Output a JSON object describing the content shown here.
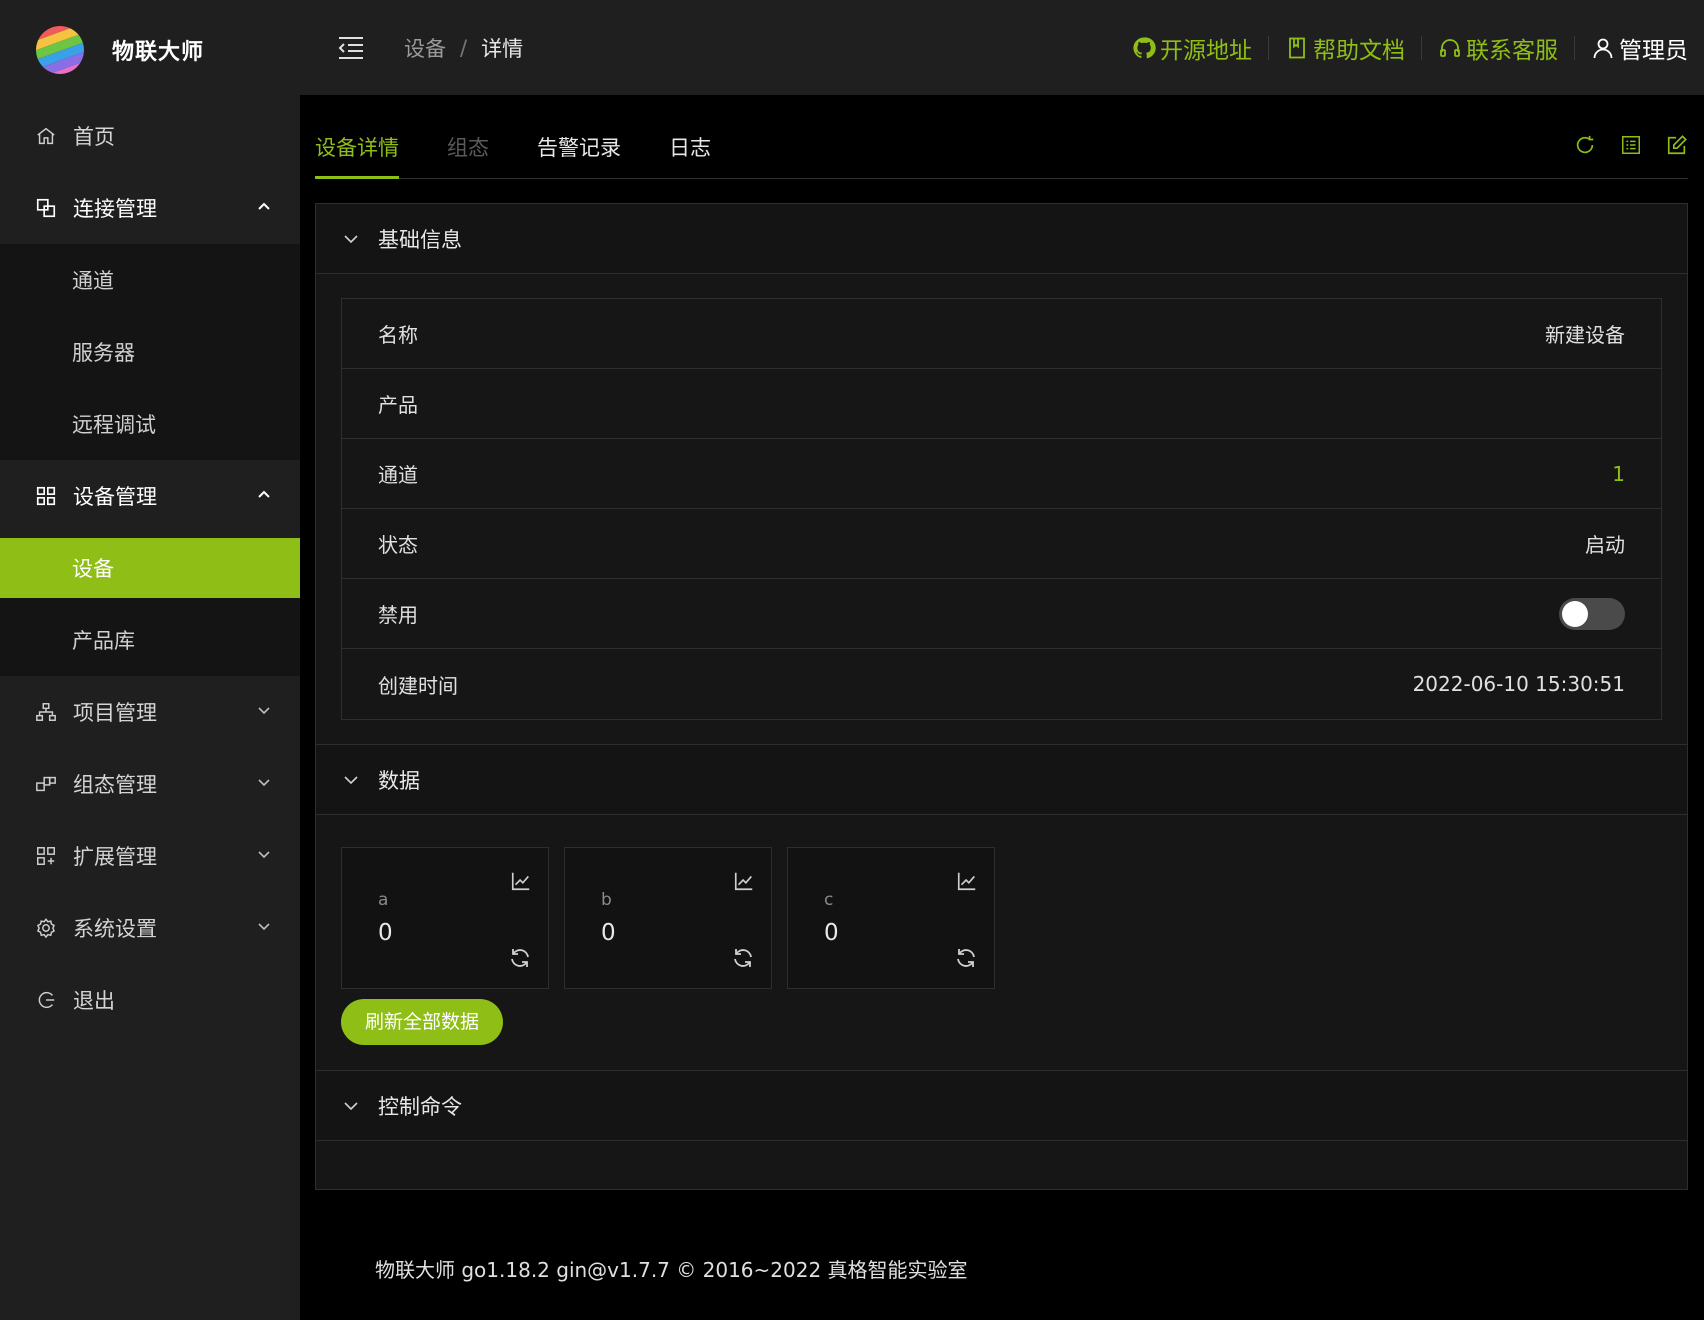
{
  "app": {
    "name": "物联大师"
  },
  "sidebar": {
    "items": [
      {
        "label": "首页",
        "icon": "home-icon"
      },
      {
        "label": "连接管理",
        "icon": "link-icon",
        "expanded": true,
        "children": [
          {
            "label": "通道"
          },
          {
            "label": "服务器"
          },
          {
            "label": "远程调试"
          }
        ]
      },
      {
        "label": "设备管理",
        "icon": "grid-icon",
        "expanded": true,
        "children": [
          {
            "label": "设备",
            "active": true
          },
          {
            "label": "产品库"
          }
        ]
      },
      {
        "label": "项目管理",
        "icon": "sitemap-icon"
      },
      {
        "label": "组态管理",
        "icon": "blocks-icon"
      },
      {
        "label": "扩展管理",
        "icon": "apps-icon"
      },
      {
        "label": "系统设置",
        "icon": "gear-icon"
      },
      {
        "label": "退出",
        "icon": "logout-icon"
      }
    ]
  },
  "header": {
    "breadcrumb": [
      "设备",
      "详情"
    ],
    "breadcrumb_sep": "/",
    "links": [
      {
        "label": "开源地址",
        "icon": "github-icon"
      },
      {
        "label": "帮助文档",
        "icon": "book-icon"
      },
      {
        "label": "联系客服",
        "icon": "headset-icon"
      }
    ],
    "user": {
      "label": "管理员",
      "icon": "user-icon"
    }
  },
  "tabs": [
    {
      "label": "设备详情",
      "active": true
    },
    {
      "label": "组态",
      "disabled": true
    },
    {
      "label": "告警记录"
    },
    {
      "label": "日志"
    }
  ],
  "basic": {
    "title": "基础信息",
    "rows": [
      {
        "label": "名称",
        "value": "新建设备"
      },
      {
        "label": "产品",
        "value": ""
      },
      {
        "label": "通道",
        "value": "1"
      },
      {
        "label": "状态",
        "value": "启动"
      },
      {
        "label": "禁用",
        "switch_on": false
      },
      {
        "label": "创建时间",
        "value": "2022-06-10 15:30:51"
      }
    ]
  },
  "data_panel": {
    "title": "数据",
    "points": [
      {
        "name": "a",
        "value": "0"
      },
      {
        "name": "b",
        "value": "0"
      },
      {
        "name": "c",
        "value": "0"
      }
    ],
    "refresh_all_label": "刷新全部数据"
  },
  "command_panel": {
    "title": "控制命令"
  },
  "footer": {
    "text": "物联大师 go1.18.2 gin@v1.7.7 © 2016~2022 真格智能实验室"
  },
  "colors": {
    "accent": "#8fbf17",
    "sidebar_bg": "#1f1f1f",
    "page_bg": "#000000"
  }
}
